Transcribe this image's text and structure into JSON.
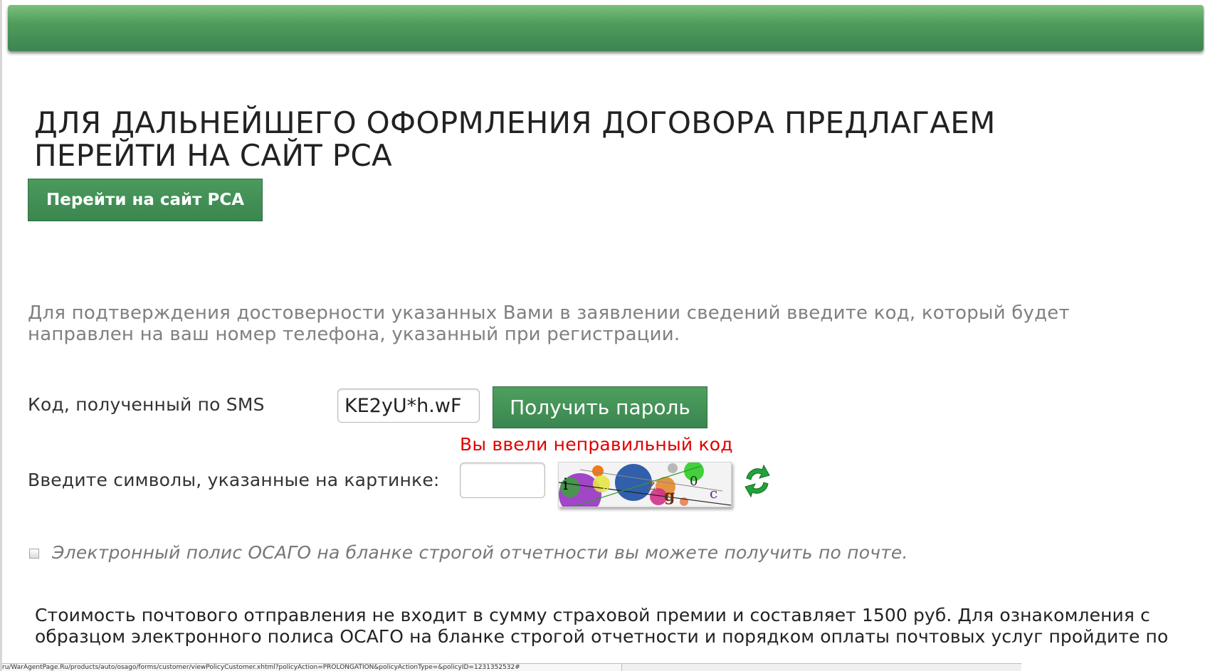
{
  "header": {
    "bar_color": "#3d8452"
  },
  "main": {
    "headline": "ДЛЯ ДАЛЬНЕЙШЕГО ОФОРМЛЕНИЯ ДОГОВОРА ПРЕДЛАГАЕМ ПЕРЕЙТИ НА САЙТ РСА",
    "rsa_button_label": "Перейти на сайт РСА",
    "info_text": "Для подтверждения достоверности указанных Вами в заявлении сведений введите код, который будет направлен на ваш номер телефона, указанный при регистрации."
  },
  "sms": {
    "label": "Код, полученный по SMS",
    "input_value": "KE2yU*h.wF",
    "get_password_label": "Получить пароль",
    "error": "Вы ввели неправильный код"
  },
  "captcha": {
    "label": "Введите символы, указанные на картинке:",
    "input_value": "",
    "image_chars": [
      "i",
      "0",
      "z",
      "g",
      "0",
      "c"
    ],
    "refresh_icon": "refresh-arrows-icon"
  },
  "postal": {
    "checkbox_checked": false,
    "checkbox_label": "Электронный полис ОСАГО на бланке строгой отчетности вы можете получить по почте.",
    "cost_text": "Стоимость почтового отправления не входит в сумму страховой премии и составляет 1500 руб. Для ознакомления с образцом электронного полиса ОСАГО на бланке строгой отчетности и порядком оплаты почтовых услуг пройдите по"
  },
  "status_bar": {
    "url": "ru/WarAgentPage.Ru/products/auto/osago/forms/customer/viewPolicyCustomer.xhtml?policyAction=PROLONGATION&policyActionType=&policyID=1231352532#"
  },
  "colors": {
    "accent_green": "#3a8650",
    "error_red": "#e00000",
    "muted_text": "#808080"
  }
}
